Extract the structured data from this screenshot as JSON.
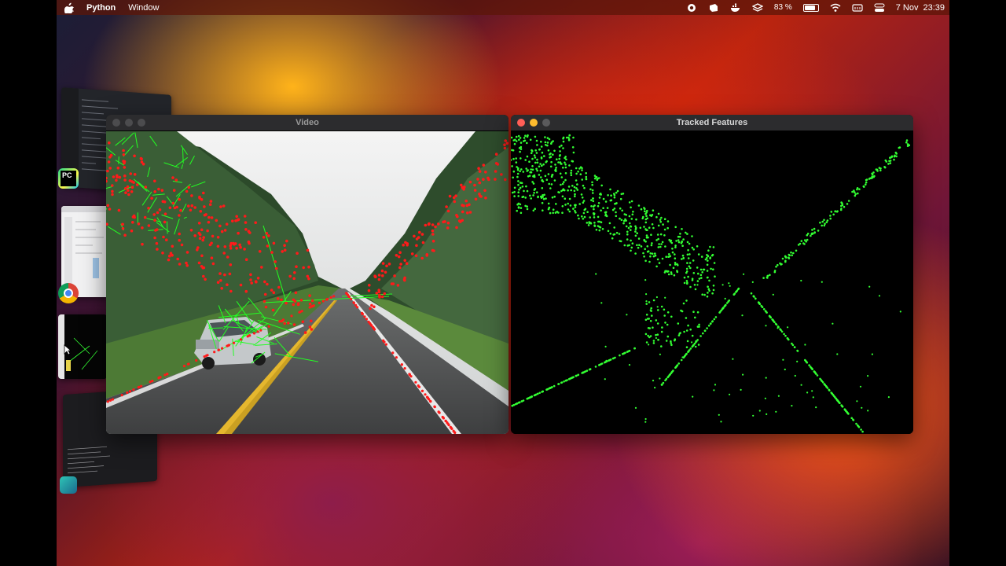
{
  "menubar": {
    "app_name": "Python",
    "menu_items": [
      "Window"
    ],
    "battery": "83 %",
    "battery_level": 0.83,
    "date": "7 Nov",
    "time": "23:39",
    "status_icons": [
      "record-icon",
      "layers-icon",
      "docker-icon",
      "stack-icon",
      "wifi-icon",
      "keyboard-icon",
      "control-center-icon"
    ]
  },
  "windows": {
    "video": {
      "title": "Video",
      "active": false
    },
    "tracked": {
      "title": "Tracked Features",
      "active": true
    }
  },
  "stage_manager": {
    "apps": [
      "pycharm-icon",
      "chrome-icon",
      "terminal-icon"
    ],
    "pycharm_label": "PC"
  },
  "colors": {
    "feature_point": "#ff1a1a",
    "flow_line": "#22ff22",
    "tracked_point": "#33ff33",
    "close": "#ff5f57",
    "minimize": "#febc2e",
    "maximize": "#5a5a5c"
  }
}
